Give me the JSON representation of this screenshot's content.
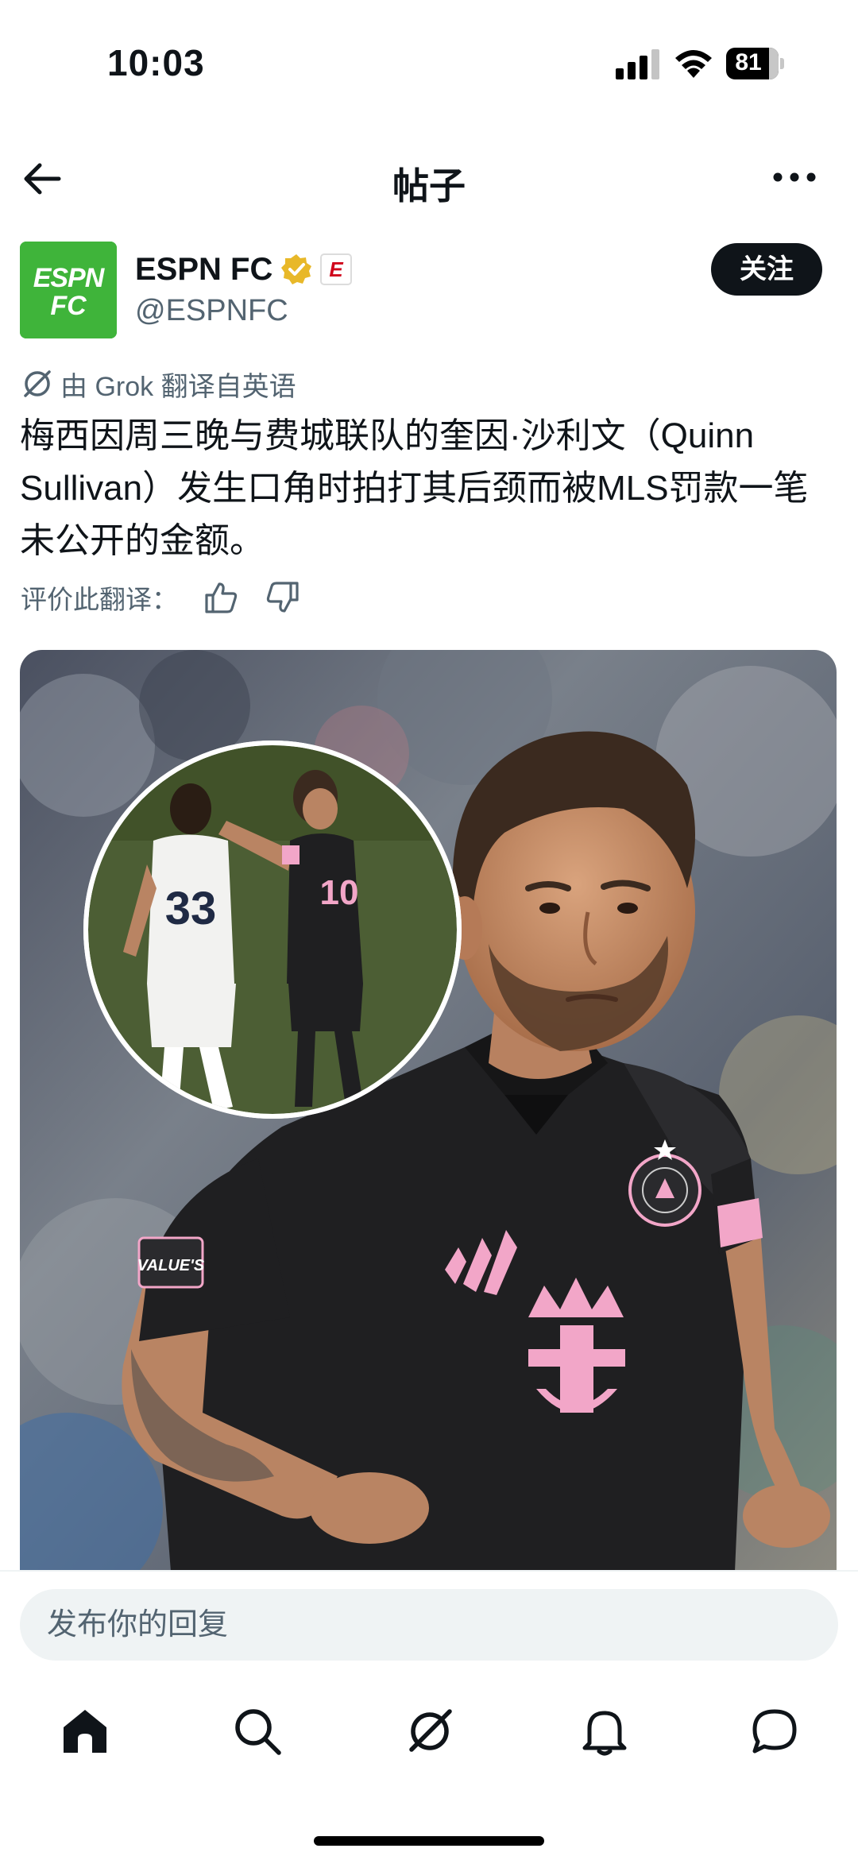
{
  "status_bar": {
    "time": "10:03",
    "battery": "81",
    "icons": [
      "cellular-signal-icon",
      "wifi-icon",
      "battery-icon"
    ]
  },
  "header": {
    "title": "帖子",
    "back_icon": "arrow-left-icon",
    "more_icon": "more-horizontal-icon"
  },
  "author": {
    "name": "ESPN FC",
    "handle": "@ESPNFC",
    "avatar_text": [
      "ESPN",
      "FC"
    ],
    "affiliate_text": "E",
    "follow_label": "关注",
    "brand_color": "#3fb43a",
    "verified_color": "#e8b829"
  },
  "translation": {
    "note": "由 Grok 翻译自英语",
    "icon": "grok-icon"
  },
  "post": {
    "text": "梅西因周三晚与费城联队的奎因·沙利文（Quinn Sullivan）发生口角时拍打其后颈而被MLS罚款一笔未公开的金额。"
  },
  "rating": {
    "label": "评价此翻译：",
    "icons": [
      "thumbs-up-icon",
      "thumbs-down-icon"
    ]
  },
  "media": {
    "inset_jersey_numbers": [
      "33",
      "10"
    ],
    "sleeve_badge_text": "VALUE'S",
    "kit_colors": {
      "shirt": "#1f1f21",
      "accent": "#f2a6c8"
    }
  },
  "reply": {
    "placeholder": "发布你的回复"
  },
  "nav": {
    "items": [
      "home-icon",
      "search-icon",
      "grok-icon",
      "notifications-icon",
      "messages-icon"
    ]
  }
}
